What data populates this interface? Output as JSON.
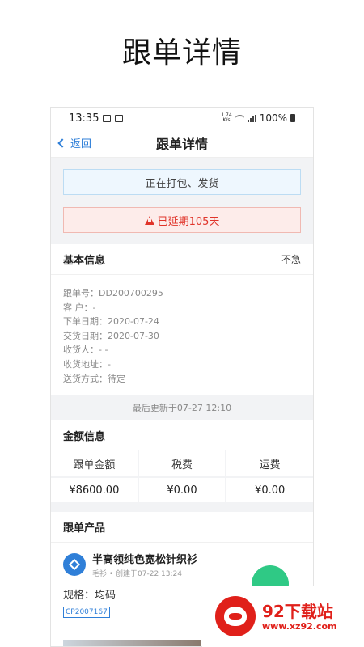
{
  "page_heading": "跟单详情",
  "statusbar": {
    "time": "13:35",
    "speed_top": "1.74",
    "speed_bottom": "K/s",
    "battery": "100%"
  },
  "navbar": {
    "back_label": "返回",
    "title": "跟单详情"
  },
  "status": {
    "current": "正在打包、发货",
    "warning": "已延期105天"
  },
  "basic_info": {
    "title": "基本信息",
    "urgency": "不急",
    "rows": [
      "跟单号：DD200700295",
      "客 户：-",
      "下单日期：2020-07-24",
      "交货日期：2020-07-30",
      "收货人：-  -",
      "收货地址：-",
      "送货方式：待定"
    ],
    "updated": "最后更新于07-27 12:10"
  },
  "amount": {
    "title": "金额信息",
    "columns": [
      {
        "label": "跟单金额",
        "value": "¥8600.00"
      },
      {
        "label": "税费",
        "value": "¥0.00"
      },
      {
        "label": "运费",
        "value": "¥0.00"
      }
    ]
  },
  "products": {
    "title": "跟单产品",
    "item": {
      "name": "半高领纯色宽松针织衫",
      "meta": "毛衫 • 创建于07-22 13:24",
      "spec": "规格：均码",
      "code": "CP2007167"
    }
  },
  "watermark": {
    "title": "92下载站",
    "url": "www.xz92.com"
  },
  "colors": {
    "accent": "#2f7fd8",
    "warning": "#e0342a",
    "success": "#2fc985",
    "brand_red": "#e0201a"
  }
}
